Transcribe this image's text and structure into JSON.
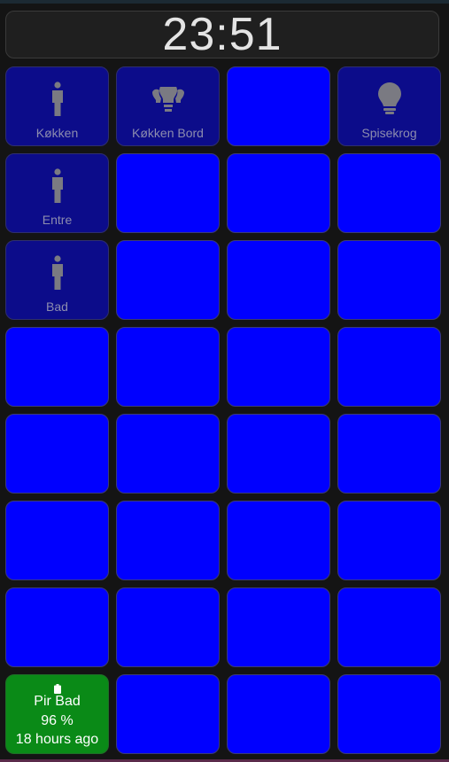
{
  "header": {
    "time": "23:51"
  },
  "tiles": {
    "t1": {
      "label": "Køkken",
      "icon": "person-icon"
    },
    "t2": {
      "label": "Køkken Bord",
      "icon": "lightbulb-group-icon"
    },
    "t4": {
      "label": "Spisekrog",
      "icon": "lightbulb-icon"
    },
    "t5": {
      "label": "Entre",
      "icon": "person-icon"
    },
    "t9": {
      "label": "Bad",
      "icon": "person-icon"
    },
    "t29": {
      "name": "Pir Bad",
      "battery": "96 %",
      "updated": "18 hours ago",
      "icon": "battery-icon"
    }
  },
  "colors": {
    "active": "#0000ff",
    "inactive": "#0c0c8a",
    "ok": "#0a8a17",
    "label": "#8c8cae"
  }
}
